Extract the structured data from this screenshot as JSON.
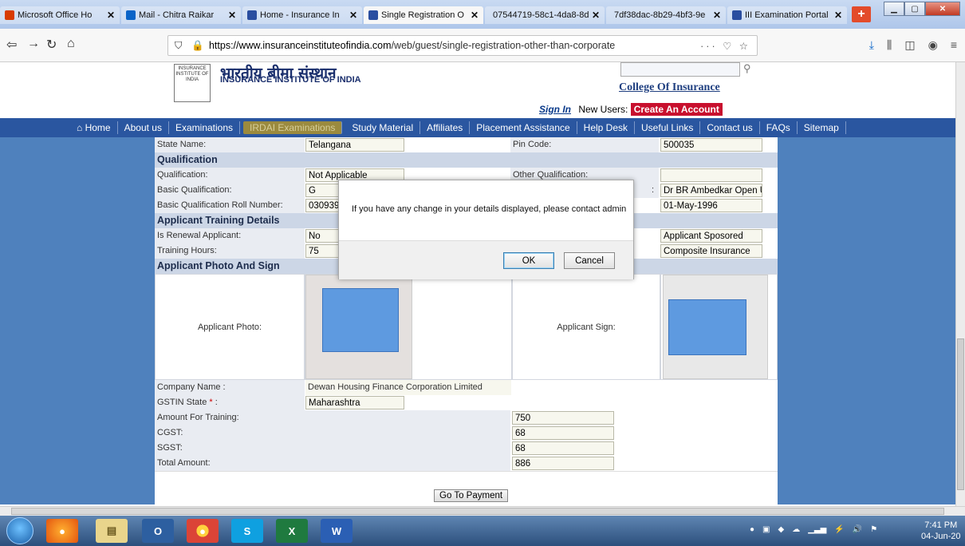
{
  "browser": {
    "tabs": [
      {
        "label": "Microsoft Office Ho",
        "color": "#d83b01",
        "active": false
      },
      {
        "label": "Mail - Chitra Raikar",
        "color": "#0a64c8",
        "active": false
      },
      {
        "label": "Home - Insurance In",
        "color": "#2a4ea0",
        "active": false
      },
      {
        "label": "Single Registration O",
        "color": "#2a4ea0",
        "active": true
      },
      {
        "label": "07544719-58c1-4da8-8d",
        "color": "",
        "active": false
      },
      {
        "label": "7df38dac-8b29-4bf3-9e",
        "color": "",
        "active": false
      },
      {
        "label": "III Examination Portal (U",
        "color": "#2a4ea0",
        "active": false
      }
    ],
    "new_tab": "+",
    "url_host": "https://www.insuranceinstituteofindia.com",
    "url_path": "/web/guest/single-registration-other-than-corporate",
    "url_actions": "··· ♡ ☆"
  },
  "header": {
    "logo_text_hi": "भारतीय बीमा संस्थान",
    "logo_text_en": "INSURANCE INSTITUTE OF INDIA",
    "logo_emblem": "INSURANCE INSTITUTE OF INDIA",
    "college": "College Of Insurance",
    "sign_in": "Sign In",
    "new_users": "New Users:",
    "create_account": "Create An Account"
  },
  "menu": [
    "Home",
    "About us",
    "Examinations",
    "IRDAI Examinations",
    "Study Material",
    "Affiliates",
    "Placement Assistance",
    "Help Desk",
    "Useful Links",
    "Contact us",
    "FAQs",
    "Sitemap"
  ],
  "form": {
    "state_label": "State Name:",
    "state_value": "Telangana",
    "pin_label": "Pin Code:",
    "pin_value": "500035",
    "qualification_section": "Qualification",
    "qual_label": "Qualification:",
    "qual_value": "Not Applicable",
    "other_qual_label": "Other Qualification:",
    "other_qual_value": "",
    "basic_qual_label": "Basic Qualification:",
    "basic_qual_value": "G",
    "board_fragment": ":",
    "board_value": "Dr BR Ambedkar Open U",
    "roll_label": "Basic Qualification Roll Number:",
    "roll_value": "030939",
    "date_value": "01-May-1996",
    "training_section": "Applicant Training Details",
    "renewal_label": "Is Renewal Applicant:",
    "renewal_value": "No",
    "sponsor_value": "Applicant Sposored",
    "hours_label": "Training Hours:",
    "hours_value": "75",
    "type_value": "Composite Insurance",
    "photo_section": "Applicant Photo And Sign",
    "photo_label": "Applicant Photo:",
    "sign_label": "Applicant Sign:",
    "company_label": "Company Name :",
    "company_value": "Dewan Housing Finance Corporation Limited",
    "gstin_label": "GSTIN State",
    "gstin_required": "*",
    "gstin_value": "Maharashtra",
    "amount_label": "Amount For Training:",
    "amount_value": "750",
    "cgst_label": "CGST:",
    "cgst_value": "68",
    "sgst_label": "SGST:",
    "sgst_value": "68",
    "total_label": "Total Amount:",
    "total_value": "886",
    "payment_button": "Go To Payment"
  },
  "dialog": {
    "message": "If you have any change in your details displayed, please contact admin",
    "ok": "OK",
    "cancel": "Cancel"
  },
  "taskbar": {
    "time": "7:41 PM",
    "date": "04-Jun-20"
  }
}
